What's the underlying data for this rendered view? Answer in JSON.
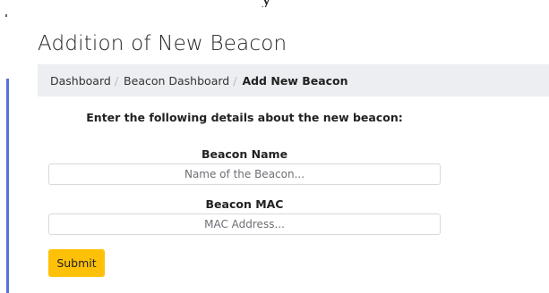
{
  "page": {
    "title": "Addition of New Beacon"
  },
  "breadcrumb": {
    "items": [
      "Dashboard",
      "Beacon Dashboard",
      "Add New Beacon"
    ],
    "separator": "/"
  },
  "form": {
    "intro": "Enter the following details about the new beacon:",
    "beacon_name": {
      "label": "Beacon Name",
      "placeholder": "Name of the Beacon...",
      "value": ""
    },
    "beacon_mac": {
      "label": "Beacon MAC",
      "placeholder": "MAC Address...",
      "value": ""
    },
    "submit_label": "Submit"
  },
  "colors": {
    "accent_bar": "#5b6fd6",
    "submit_button": "#ffc107",
    "breadcrumb_bg": "#eceef1"
  }
}
